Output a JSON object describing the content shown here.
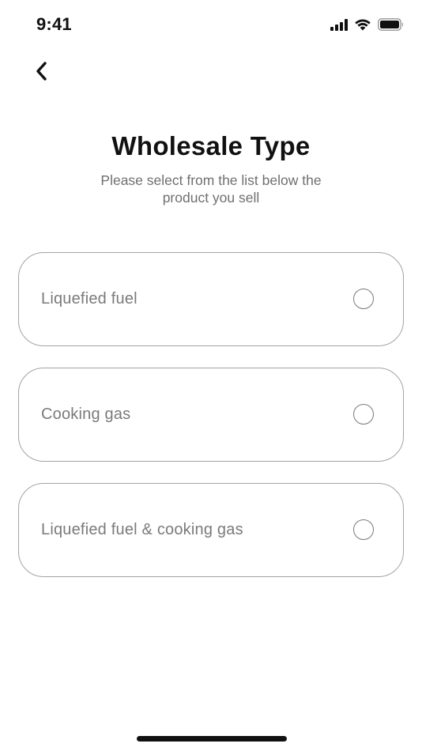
{
  "status_bar": {
    "time": "9:41",
    "icons": [
      "cellular-signal-icon",
      "wifi-icon",
      "battery-icon"
    ]
  },
  "navigation": {
    "back_icon": "chevron-left-icon"
  },
  "header": {
    "title": "Wholesale Type",
    "subtitle": "Please select from the list below the product you sell"
  },
  "options": [
    {
      "label": "Liquefied fuel",
      "selected": false
    },
    {
      "label": "Cooking gas",
      "selected": false
    },
    {
      "label": "Liquefied fuel & cooking gas",
      "selected": false
    }
  ],
  "colors": {
    "text_primary": "#111111",
    "text_secondary": "#6f6f6f",
    "option_text": "#7a7a7a",
    "card_border": "#a3a3a3",
    "background": "#ffffff"
  }
}
